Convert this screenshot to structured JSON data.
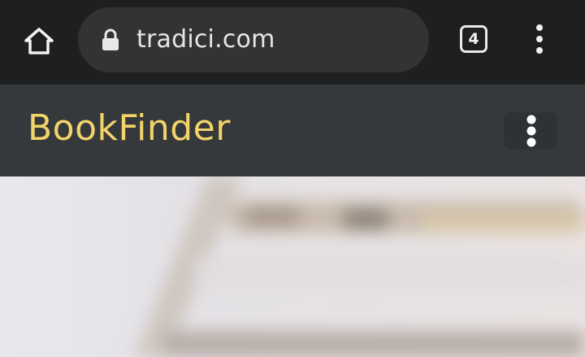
{
  "browser": {
    "url": "tradici.com",
    "tab_count": "4",
    "icons": {
      "home": "home-icon",
      "lock": "lock-icon",
      "menu": "more-vert-icon"
    }
  },
  "site": {
    "title": "BookFinder",
    "menu_icon": "more-vert-icon"
  },
  "colors": {
    "browser_bar": "#1e1f20",
    "url_pill": "#323335",
    "site_header": "#36393c",
    "title_accent": "#f3d46a"
  }
}
